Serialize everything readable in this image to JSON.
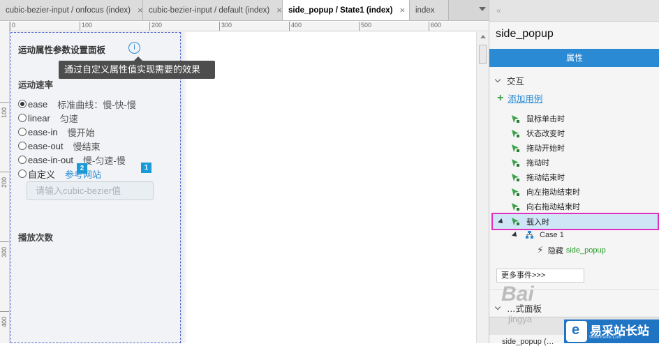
{
  "tabs": [
    {
      "label": "cubic-bezier-input / onfocus (index)",
      "active": false
    },
    {
      "label": "cubic-bezier-input / default (index)",
      "active": false
    },
    {
      "label": "side_popup / State1 (index)",
      "active": true
    },
    {
      "label": "index",
      "active": false
    }
  ],
  "tab_close_glyph": "×",
  "ruler": {
    "h_ticks": [
      "0",
      "100",
      "200",
      "300",
      "400",
      "500",
      "600"
    ],
    "v_ticks": [
      "100",
      "200",
      "300",
      "400"
    ]
  },
  "panel": {
    "title": "运动属性参数设置面板",
    "info_glyph": "i",
    "tooltip": "通过自定义属性值实现需要的效果",
    "speed_label": "运动速率",
    "options": [
      {
        "value": "ease",
        "desc": "标准曲线：慢-快-慢",
        "checked": true
      },
      {
        "value": "linear",
        "desc": "匀速",
        "checked": false
      },
      {
        "value": "ease-in",
        "desc": "慢开始",
        "checked": false
      },
      {
        "value": "ease-out",
        "desc": "慢结束",
        "checked": false
      },
      {
        "value": "ease-in-out",
        "desc": "慢-匀速-慢",
        "checked": false
      },
      {
        "value": "自定义",
        "link": "参考网站",
        "checked": false
      }
    ],
    "custom_placeholder": "请输入cubic-bezier值",
    "play_count_label": "播放次数",
    "badges": [
      "2",
      "1"
    ]
  },
  "inspector": {
    "widget_name": "side_popup",
    "tab_label": "属性",
    "interactions_label": "交互",
    "add_case_label": "添加用例",
    "events": [
      "鼠标单击时",
      "状态改变时",
      "拖动开始时",
      "拖动时",
      "拖动结束时",
      "向左拖动结束时",
      "向右拖动结束时"
    ],
    "selected_event": "载入时",
    "case_label": "Case 1",
    "action_verb": "隐藏",
    "action_target": "side_popup",
    "more_events_label": "更多事件>>>",
    "section2_label": "…式面板",
    "bottom_row": "side_popup (…"
  },
  "watermark": {
    "baidu": "Bai",
    "baidu_sub": "jingya",
    "site_name": "易采站长站",
    "site_sub": "Www.Easck.Com"
  },
  "colors": {
    "accent": "#2a8ad4",
    "selected_border": "#e030c0",
    "action_green": "#2a9a2a"
  }
}
